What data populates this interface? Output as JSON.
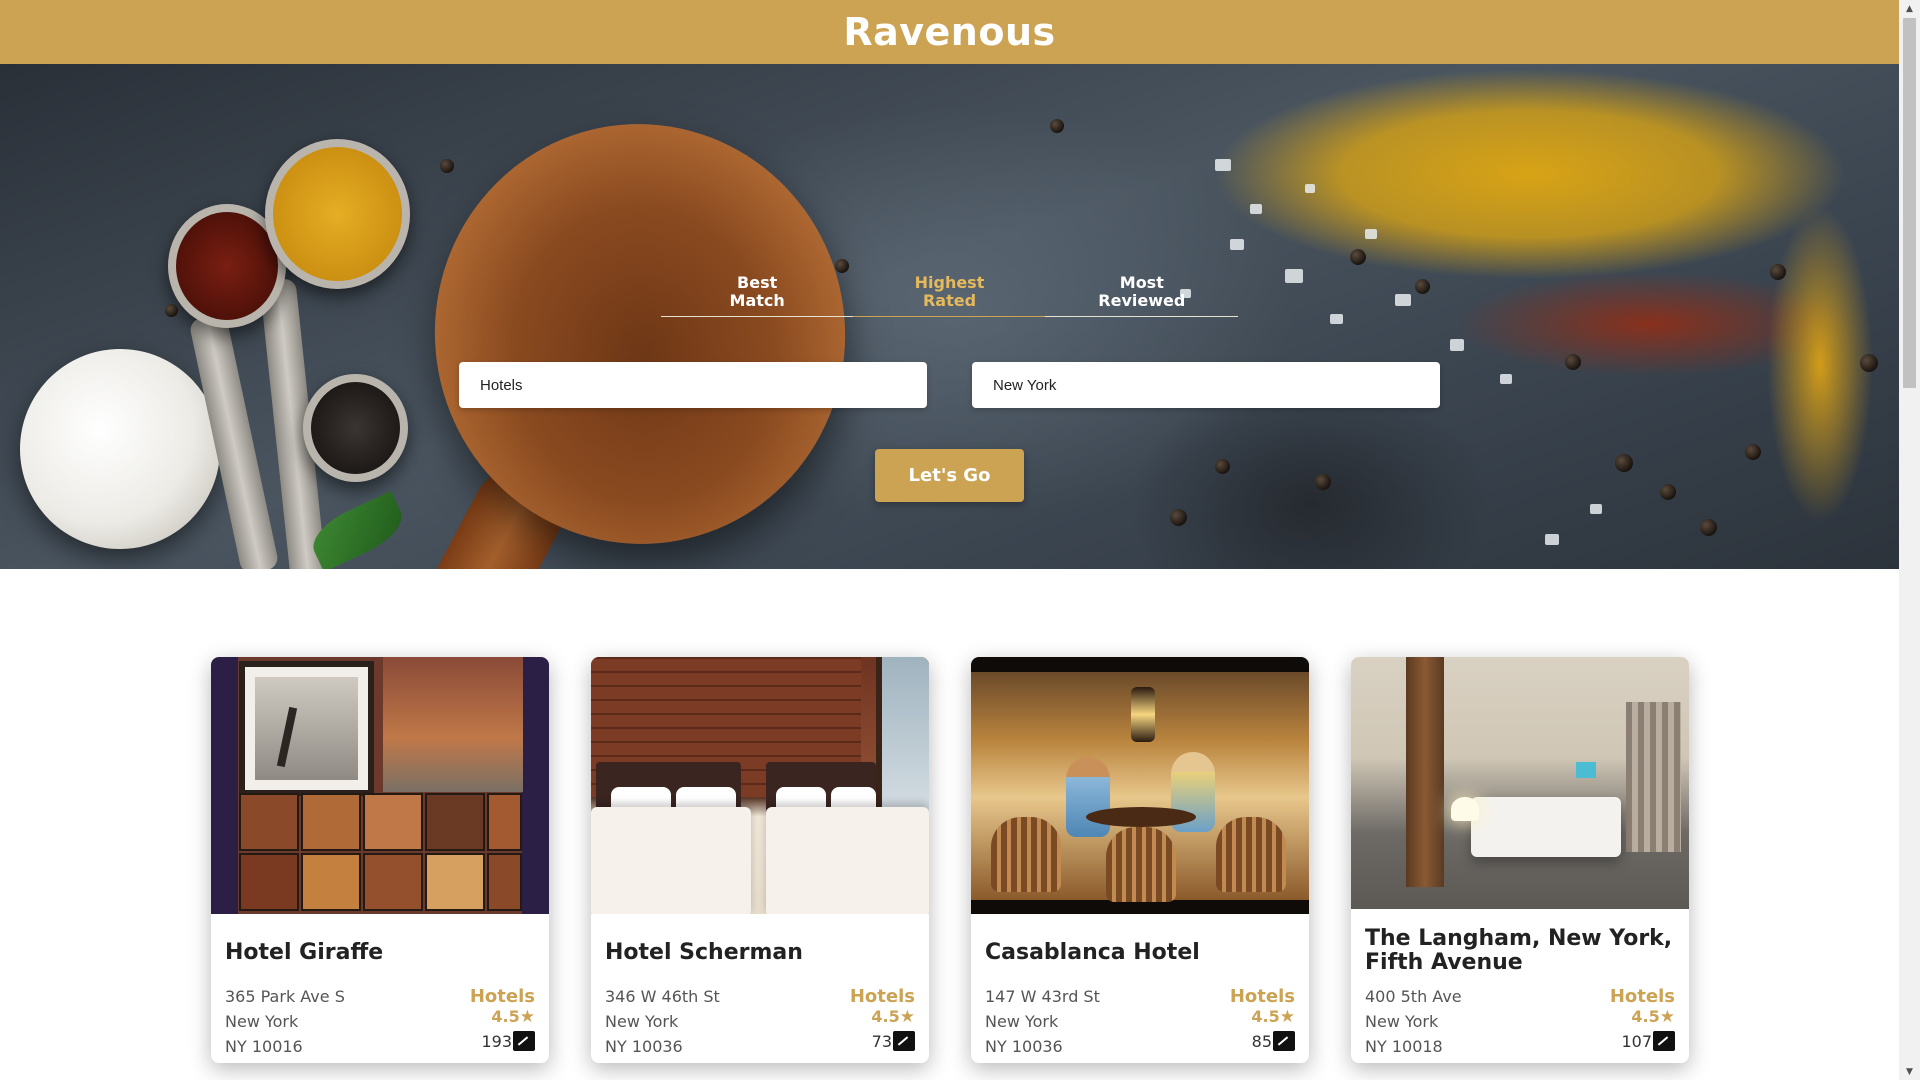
{
  "app": {
    "brand": "Ravenous"
  },
  "sort_options": [
    {
      "label_line1": "Best",
      "label_line2": "Match",
      "active": false
    },
    {
      "label_line1": "Highest",
      "label_line2": "Rated",
      "active": true
    },
    {
      "label_line1": "Most",
      "label_line2": "Reviewed",
      "active": false
    }
  ],
  "search": {
    "term_value": "Hotels",
    "location_value": "New York",
    "submit_label": "Let's Go"
  },
  "businesses": [
    {
      "name": "Hotel Giraffe",
      "address": "365 Park Ave S",
      "city": "New York",
      "state_zip": "NY 10016",
      "category": "Hotels",
      "rating": "4.5",
      "review_count": "193"
    },
    {
      "name": "Hotel Scherman",
      "address": "346 W 46th St",
      "city": "New York",
      "state_zip": "NY 10036",
      "category": "Hotels",
      "rating": "4.5",
      "review_count": "73"
    },
    {
      "name": "Casablanca Hotel",
      "address": "147 W 43rd St",
      "city": "New York",
      "state_zip": "NY 10036",
      "category": "Hotels",
      "rating": "4.5",
      "review_count": "85"
    },
    {
      "name": "The Langham, New York, Fifth Avenue",
      "address": "400 5th Ave",
      "city": "New York",
      "state_zip": "NY 10018",
      "category": "Hotels",
      "rating": "4.5",
      "review_count": "107"
    }
  ],
  "icons": {
    "rating": "star-icon",
    "reviews": "review-icon"
  },
  "colors": {
    "accent": "#cca353",
    "active_tab": "#e6b95c"
  }
}
